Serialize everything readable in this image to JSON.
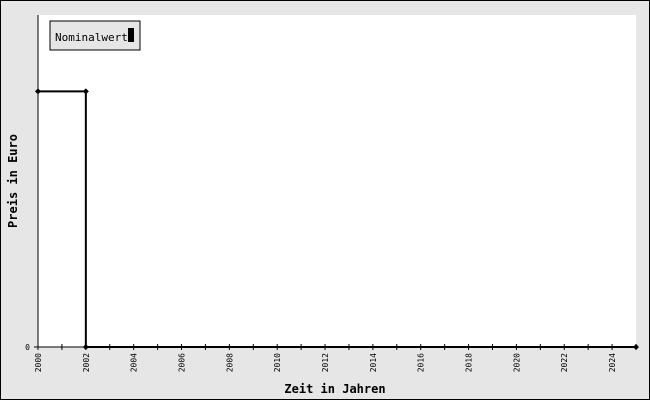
{
  "chart_data": {
    "type": "line",
    "title": "",
    "xlabel": "Zeit in Jahren",
    "ylabel": "Preis in Euro",
    "xlim": [
      2000,
      2025
    ],
    "ylim": [
      0,
      1
    ],
    "x_ticks": [
      "2000",
      "2002",
      "2004",
      "2006",
      "2008",
      "2010",
      "2012",
      "2014",
      "2016",
      "2018",
      "2020",
      "2022",
      "2024"
    ],
    "y_ticks": [
      "0"
    ],
    "grid": false,
    "legend_position": "top-left",
    "series": [
      {
        "name": "Nominalwert",
        "color": "#000000",
        "step": true,
        "x": [
          2000,
          2002,
          2002,
          2025
        ],
        "y": [
          0.77,
          0.77,
          0,
          0
        ]
      }
    ]
  }
}
